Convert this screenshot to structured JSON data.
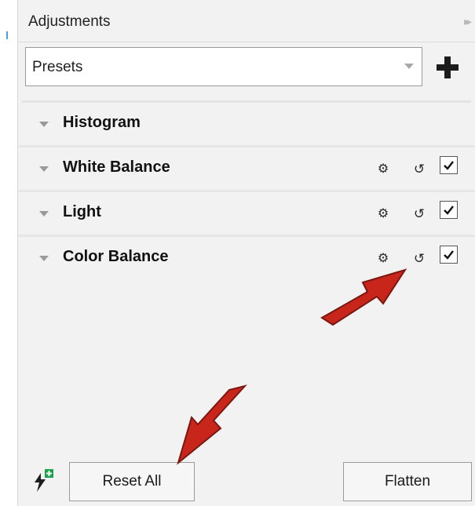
{
  "panel": {
    "title": "Adjustments",
    "collapse_icon": "double-chevron-right-icon"
  },
  "presets": {
    "value": "Presets",
    "add_icon": "plus-icon"
  },
  "adjustments": [
    {
      "label": "Histogram",
      "has_controls": false
    },
    {
      "label": "White Balance",
      "has_controls": true,
      "enabled": true
    },
    {
      "label": "Light",
      "has_controls": true,
      "enabled": true
    },
    {
      "label": "Color Balance",
      "has_controls": true,
      "enabled": true
    }
  ],
  "icons": {
    "gear": "⚙",
    "reset": "↺"
  },
  "footer": {
    "reset_all_label": "Reset All",
    "flatten_label": "Flatten",
    "quick_icon": "add-effect-icon"
  },
  "colors": {
    "panel_bg": "#f2f2f2",
    "arrow_red": "#d7261a",
    "plus_green": "#1aa34a"
  }
}
